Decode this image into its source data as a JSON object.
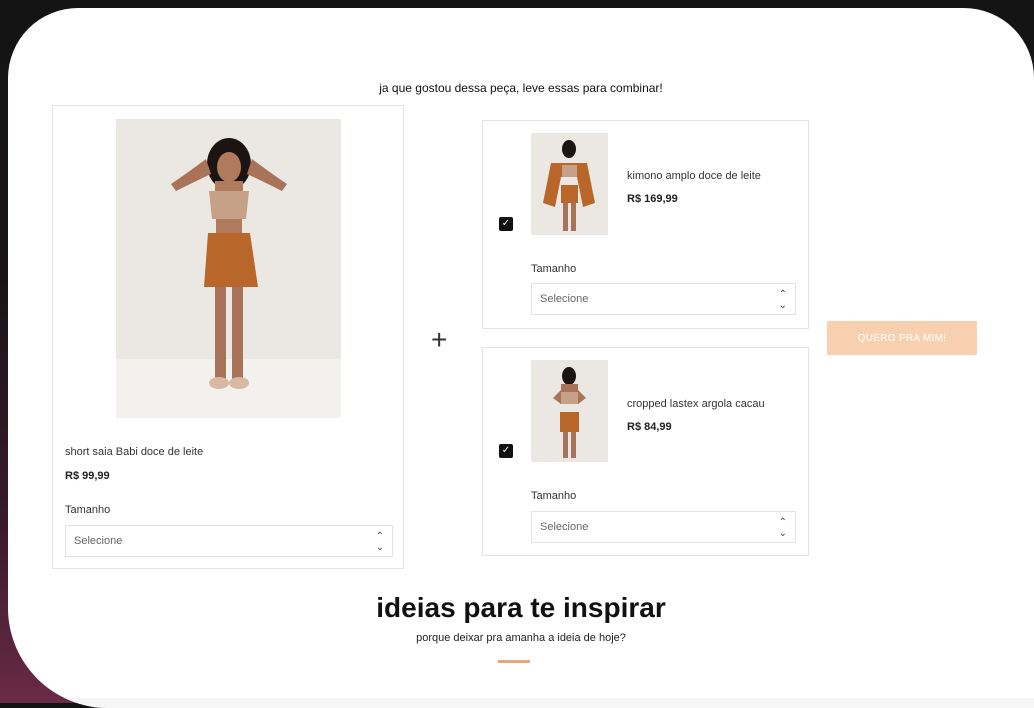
{
  "colors": {
    "accent": "#e9a774",
    "button_bg": "#f8d0b0",
    "checkbox": "#111111"
  },
  "combo": {
    "heading": "ja que gostou dessa peça, leve essas para combinar!",
    "plus_icon": "+",
    "buy_button": "QUERO PRA MIM!"
  },
  "main_product": {
    "name": "short saia Babi doce de leite",
    "price": "R$ 99,99",
    "size_label": "Tamanho",
    "size_select": "Selecione"
  },
  "recommendations": [
    {
      "name": "kimono amplo doce de leite",
      "price": "R$ 169,99",
      "checked": true,
      "size_label": "Tamanho",
      "size_select": "Selecione"
    },
    {
      "name": "cropped lastex argola cacau",
      "price": "R$ 84,99",
      "checked": true,
      "size_label": "Tamanho",
      "size_select": "Selecione"
    }
  ],
  "inspire": {
    "title": "ideias para te inspirar",
    "subtitle": "porque deixar pra amanha a ideia de hoje?"
  }
}
